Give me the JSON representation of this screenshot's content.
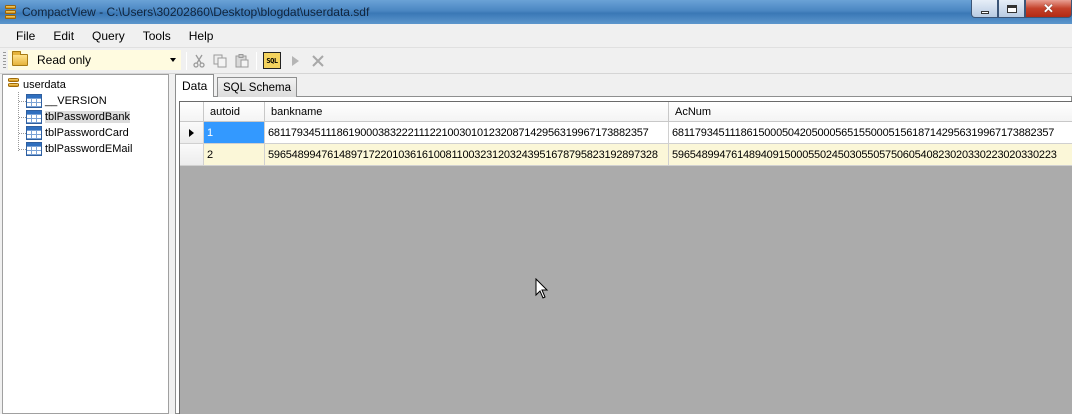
{
  "window": {
    "title": "CompactView - C:\\Users\\30202860\\Desktop\\blogdat\\userdata.sdf"
  },
  "menu": [
    "File",
    "Edit",
    "Query",
    "Tools",
    "Help"
  ],
  "toolbar": {
    "mode_value": "Read only",
    "icons": [
      "cut-icon",
      "copy-icon",
      "paste-icon",
      "sql-icon",
      "run-icon",
      "cancel-icon"
    ],
    "sql_label": "SQL"
  },
  "tree": {
    "root": "userdata",
    "children": [
      "__VERSION",
      "tblPasswordBank",
      "tblPasswordCard",
      "tblPasswordEMail"
    ],
    "selected": "tblPasswordBank"
  },
  "tabs": [
    "Data",
    "SQL Schema"
  ],
  "grid": {
    "columns": [
      "autoid",
      "bankname",
      "AcNum"
    ],
    "rows": [
      [
        "1",
        "68117934511186190003832221112210030101232087142956319967173882357",
        "68117934511186150005042050005651550005156187142956319967173882357"
      ],
      [
        "2",
        "596548994761489717220103616100811003231203243951678795823192897328",
        "59654899476148940915000550245030550575060540823020330223020330223"
      ]
    ]
  },
  "colors": {
    "selected_cell": "#3399ff",
    "alt_row": "#fbf7d8",
    "grid_empty": "#ababab"
  }
}
